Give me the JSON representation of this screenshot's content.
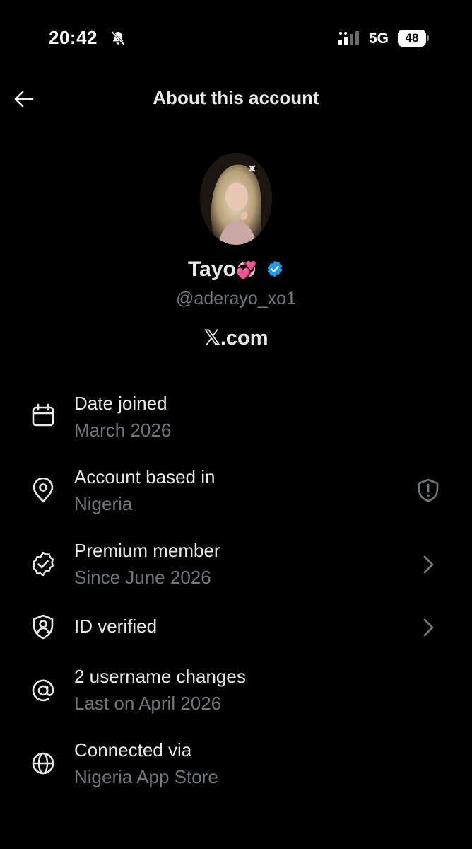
{
  "status_bar": {
    "time": "20:42",
    "network": "5G",
    "battery": "48"
  },
  "header": {
    "title": "About this account"
  },
  "profile": {
    "display_name": "Tayo",
    "name_emoji": "💞",
    "handle": "@aderayo_xo1",
    "site": "𝕏.com"
  },
  "details": [
    {
      "label": "Date joined",
      "value": "March 2026",
      "icon": "calendar-icon"
    },
    {
      "label": "Account based in",
      "value": "Nigeria",
      "icon": "location-pin-icon",
      "right_icon": "shield-alert-icon"
    },
    {
      "label": "Premium member",
      "value": "Since June 2026",
      "icon": "verified-badge-icon",
      "right_icon": "chevron-right-icon"
    },
    {
      "label": "ID verified",
      "icon": "id-shield-icon",
      "right_icon": "chevron-right-icon"
    },
    {
      "label": "2 username changes",
      "value": "Last on April 2026",
      "icon": "at-sign-icon"
    },
    {
      "label": "Connected via",
      "value": "Nigeria App Store",
      "icon": "globe-icon"
    }
  ],
  "colors": {
    "background": "#000000",
    "text_primary": "#e7e9ea",
    "text_secondary": "#71767b",
    "verified_blue": "#1d9bf0"
  }
}
